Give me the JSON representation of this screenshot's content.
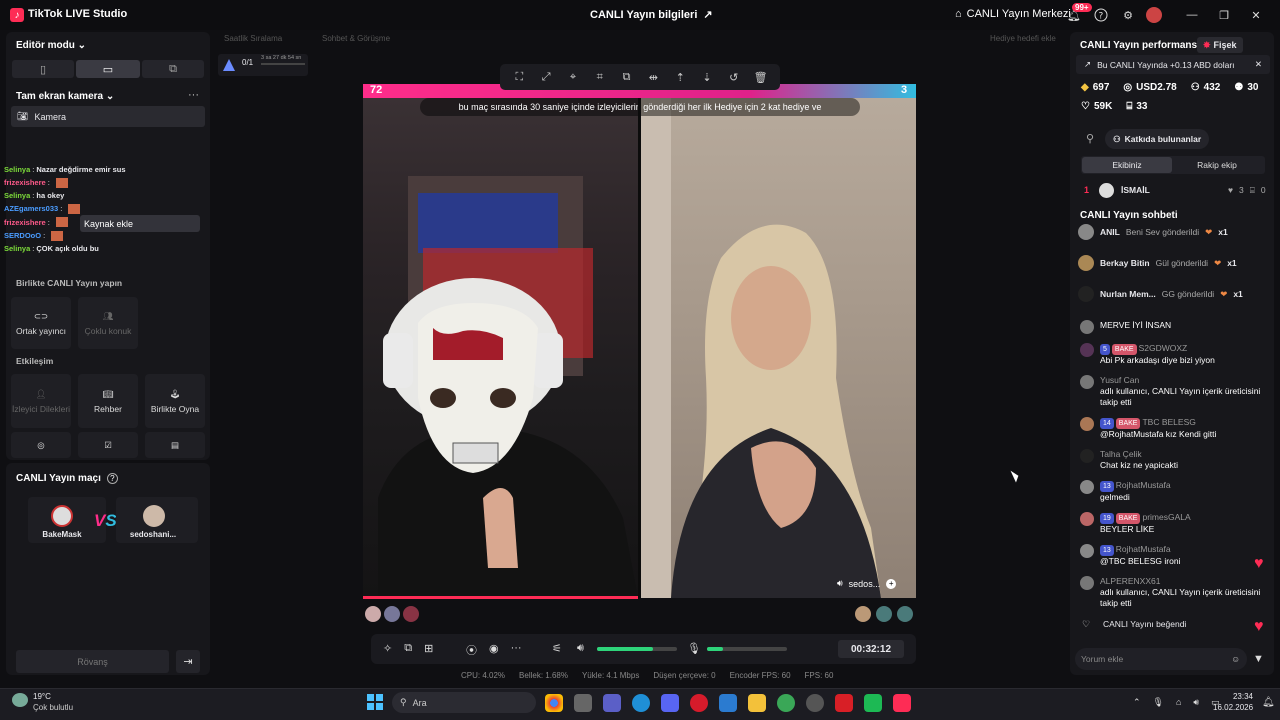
{
  "window": {
    "app_title": "TikTok LIVE Studio",
    "stream_info": "CANLI Yayın bilgileri",
    "live_center": "CANLI Yayın Merkezi",
    "notif_count": "99+"
  },
  "left": {
    "editor_mode": "Editör modu",
    "camera_section": "Tam ekran kamera",
    "camera_item": "Kamera",
    "add_source": "Kaynak ekle",
    "chat": [
      {
        "user": "Selinya",
        "text": "Nazar değdirme emir sus",
        "color": "#7ddc3a"
      },
      {
        "user": "frizexishere",
        "text": "",
        "color": "#ff5a8a"
      },
      {
        "user": "Selinya",
        "text": "ha okey",
        "color": "#7ddc3a"
      },
      {
        "user": "AZEgamers033",
        "text": "",
        "color": "#4a9cff"
      },
      {
        "user": "frizexishere",
        "text": "",
        "color": "#ff5a8a"
      },
      {
        "user": "SERDOoO",
        "text": "",
        "color": "#4a9cff"
      },
      {
        "user": "Selinya",
        "text": "ÇOK açık oldu bu",
        "color": "#7ddc3a"
      }
    ],
    "collab_title": "Birlikte CANLI Yayın yapın",
    "collab_tiles": [
      "Ortak yayıncı",
      "Çoklu konuk"
    ],
    "interact_title": "Etkileşim",
    "interact_tiles": [
      "İzleyici Dilekleri",
      "Rehber",
      "Birlikte Oyna"
    ],
    "match_title": "CANLI Yayın maçı",
    "player_left": "BakeMask",
    "player_right": "sedoshani...",
    "rematch": "Rövanş"
  },
  "center": {
    "tab_a": "Saatlik Sıralama",
    "tab_b": "Sohbet & Görüşme",
    "tab_c": "Hediye hedefi ekle",
    "goal_count": "0/1",
    "goal_time": "3 sa 27 dk 54 sn",
    "score_left": "72",
    "score_right": "3",
    "banner": "bu maç sırasında 30 saniye içinde izleyicilerin gönderdiği her ilk Hediye için 2 kat hediye ve",
    "cam_label": "sedos...",
    "timer": "00:32:12",
    "stats": [
      "CPU: 4.02%",
      "Bellek: 1.68%",
      "Yükle: 4.1 Mbps",
      "Düşen çerçeve: 0",
      "Encoder FPS: 60",
      "FPS: 60"
    ]
  },
  "right": {
    "perf_title": "CANLI Yayın performansı",
    "fisek": "Fişek",
    "promo": "Bu CANLI Yayında +0.13 ABD doları",
    "metrics": {
      "diamonds": "697",
      "usd": "USD2.78",
      "users": "432",
      "viewers": "30",
      "likes": "59K",
      "gifts": "33"
    },
    "contributors_btn": "Katkıda bulunanlar",
    "team_tab": "Ekibiniz",
    "rival_tab": "Rakip ekip",
    "top_rank": "1",
    "top_user": "İSMAİL",
    "top_stat_a": "3",
    "top_stat_b": "0",
    "chat_title": "CANLI Yayın sohbeti",
    "gifts": [
      {
        "user": "ANIL",
        "text": "Beni Sev gönderildi",
        "mult": "x1"
      },
      {
        "user": "Berkay Bitin",
        "text": "Gül gönderildi",
        "mult": "x1"
      },
      {
        "user": "Nurlan Mem...",
        "text": "GG gönderildi",
        "mult": "x1"
      }
    ],
    "messages": [
      {
        "lvl": "",
        "badge": "",
        "user": "",
        "text": "MERVE İYİ İNSAN"
      },
      {
        "lvl": "5",
        "badge": "BAKE",
        "user": "S2GDWOXZ",
        "text": "Abi Pk arkadaşı diye bizi yiyon"
      },
      {
        "lvl": "",
        "badge": "",
        "user": "Yusuf Can",
        "text": "adlı kullanıcı, CANLI Yayın içerik üreticisini takip etti"
      },
      {
        "lvl": "14",
        "badge": "BAKE",
        "user": "TBC BELESG",
        "text": "@RojhatMustafa kız Kendi gitti"
      },
      {
        "lvl": "",
        "badge": "",
        "user": "Talha Çelik",
        "text": "Chat kiz ne yapicakti"
      },
      {
        "lvl": "13",
        "badge": "",
        "user": "RojhatMustafa",
        "text": "gelmedi"
      },
      {
        "lvl": "19",
        "badge": "BAKE",
        "user": "primesGALA",
        "text": "BEYLER LİKE"
      },
      {
        "lvl": "13",
        "badge": "",
        "user": "RojhatMustafa",
        "text": "@TBC BELESG ironi"
      },
      {
        "lvl": "",
        "badge": "",
        "user": "ALPERENXX61",
        "text": "adlı kullanıcı, CANLI Yayın içerik üreticisini takip etti"
      }
    ],
    "liked": "CANLI Yayını beğendi",
    "comment_placeholder": "Yorum ekle"
  },
  "taskbar": {
    "temp": "19°C",
    "weather": "Çok bulutlu",
    "search": "Ara",
    "time": "23:34",
    "date": "16.02.2026"
  },
  "colors": {
    "accent": "#fe2c55",
    "pink": "#ff2d8a",
    "cyan": "#31bde0",
    "green": "#2ed47a"
  }
}
